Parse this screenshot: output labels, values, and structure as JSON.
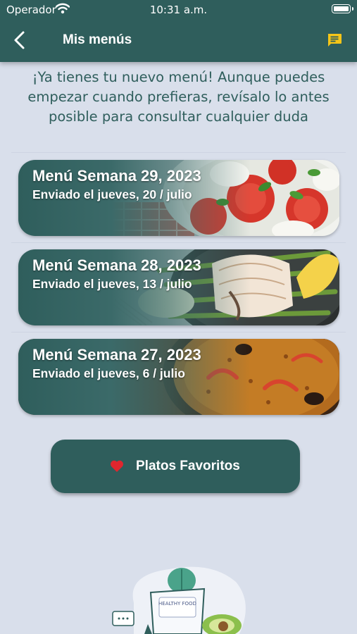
{
  "status_bar": {
    "carrier": "Operador",
    "time": "10:31 a.m."
  },
  "header": {
    "title": "Mis menús",
    "back_icon": "chevron-left-icon",
    "chat_icon": "chat-bubble-icon"
  },
  "intro": "¡Ya tienes tu nuevo menú! Aunque puedes empezar cuando prefieras, revísalo lo antes posible para consultar cualquier duda",
  "menus": [
    {
      "name": "Menú Semana 29, 2023",
      "sent": "Enviado el jueves, 20 / julio",
      "image": "caprese-salad"
    },
    {
      "name": "Menú Semana 28, 2023",
      "sent": "Enviado el jueves, 13 / julio",
      "image": "grilled-salmon"
    },
    {
      "name": "Menú Semana 27, 2023",
      "sent": "Enviado el jueves, 6 / julio",
      "image": "paella"
    }
  ],
  "favorites": {
    "label": "Platos Favoritos",
    "icon": "heart-icon"
  },
  "illustration": {
    "badge_text": "HEALTHY FOOD"
  },
  "colors": {
    "primary": "#2f5e5c",
    "background": "#d9dfeb",
    "accent": "#f5c518",
    "heart": "#e0262e"
  }
}
